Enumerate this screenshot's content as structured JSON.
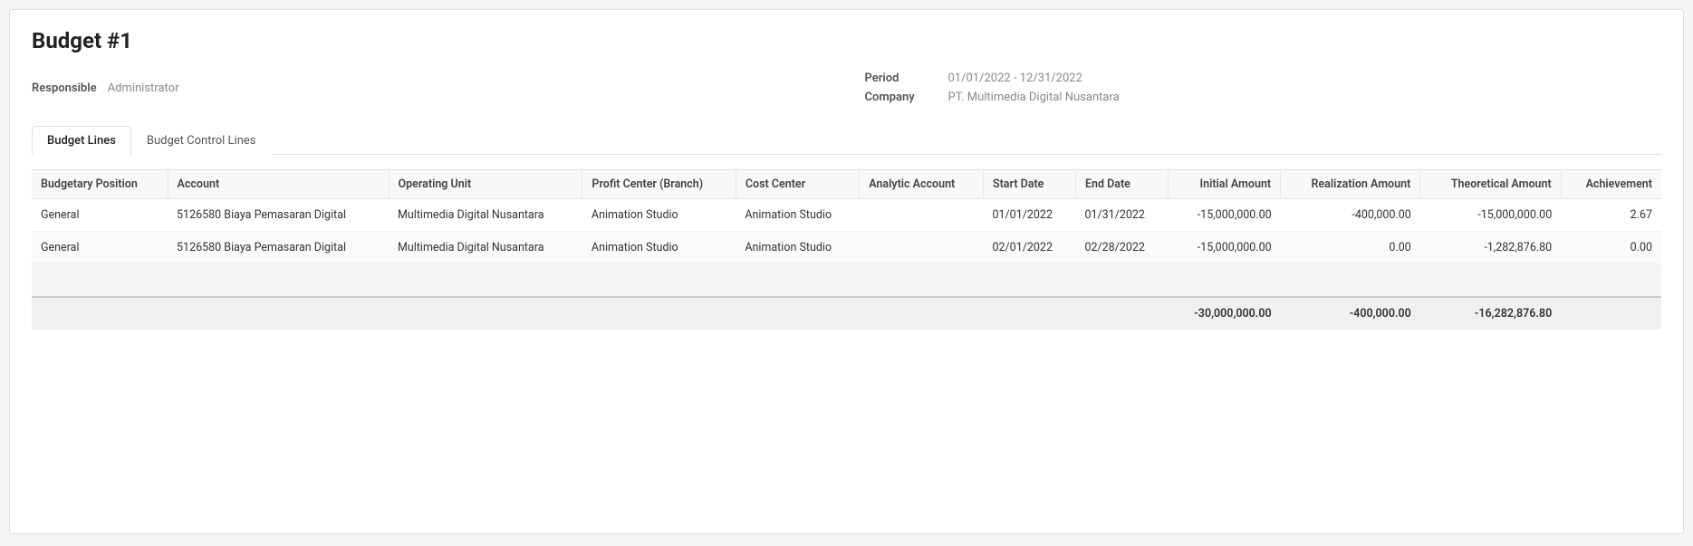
{
  "page": {
    "title": "Budget #1"
  },
  "form": {
    "responsible_label": "Responsible",
    "responsible_value": "Administrator",
    "period_label": "Period",
    "period_value": "01/01/2022 - 12/31/2022",
    "company_label": "Company",
    "company_value": "PT. Multimedia Digital Nusantara"
  },
  "tabs": [
    {
      "id": "budget-lines",
      "label": "Budget Lines",
      "active": true
    },
    {
      "id": "budget-control-lines",
      "label": "Budget Control Lines",
      "active": false
    }
  ],
  "table": {
    "columns": [
      {
        "id": "budgetary-position",
        "label": "Budgetary Position",
        "numeric": false
      },
      {
        "id": "account",
        "label": "Account",
        "numeric": false
      },
      {
        "id": "operating-unit",
        "label": "Operating Unit",
        "numeric": false
      },
      {
        "id": "profit-center",
        "label": "Profit Center (Branch)",
        "numeric": false
      },
      {
        "id": "cost-center",
        "label": "Cost Center",
        "numeric": false
      },
      {
        "id": "analytic-account",
        "label": "Analytic Account",
        "numeric": false
      },
      {
        "id": "start-date",
        "label": "Start Date",
        "numeric": false
      },
      {
        "id": "end-date",
        "label": "End Date",
        "numeric": false
      },
      {
        "id": "initial-amount",
        "label": "Initial Amount",
        "numeric": true
      },
      {
        "id": "realization-amount",
        "label": "Realization Amount",
        "numeric": true
      },
      {
        "id": "theoretical-amount",
        "label": "Theoretical Amount",
        "numeric": true
      },
      {
        "id": "achievement",
        "label": "Achievement",
        "numeric": true
      }
    ],
    "rows": [
      {
        "budgetary_position": "General",
        "account": "5126580 Biaya Pemasaran Digital",
        "operating_unit": "Multimedia Digital Nusantara",
        "profit_center": "Animation Studio",
        "cost_center": "Animation Studio",
        "analytic_account": "",
        "start_date": "01/01/2022",
        "end_date": "01/31/2022",
        "initial_amount": "-15,000,000.00",
        "realization_amount": "-400,000.00",
        "theoretical_amount": "-15,000,000.00",
        "achievement": "2.67"
      },
      {
        "budgetary_position": "General",
        "account": "5126580 Biaya Pemasaran Digital",
        "operating_unit": "Multimedia Digital Nusantara",
        "profit_center": "Animation Studio",
        "cost_center": "Animation Studio",
        "analytic_account": "",
        "start_date": "02/01/2022",
        "end_date": "02/28/2022",
        "initial_amount": "-15,000,000.00",
        "realization_amount": "0.00",
        "theoretical_amount": "-1,282,876.80",
        "achievement": "0.00"
      }
    ],
    "footer": {
      "initial_total": "-30,000,000.00",
      "realization_total": "-400,000.00",
      "theoretical_total": "-16,282,876.80"
    }
  }
}
